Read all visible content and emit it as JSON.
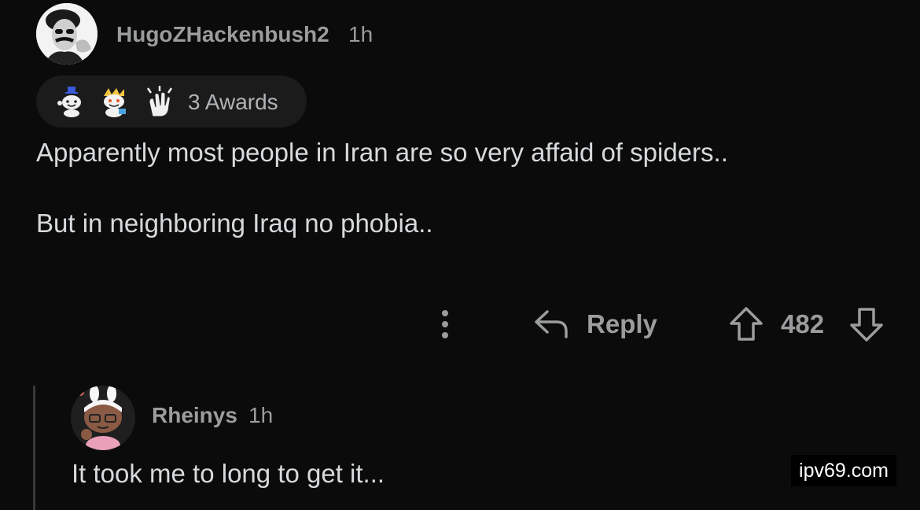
{
  "colors": {
    "background": "#0b0b0b",
    "text_primary": "#d7dadc",
    "text_secondary": "#9a9c9e",
    "pill_background": "#1b1b1c",
    "thread_line": "#3a3a3c"
  },
  "comment": {
    "username": "HugoZHackenbush2",
    "time": "1h",
    "avatar_icon": "avatar-groucho-icon",
    "awards": {
      "icons": [
        "award-wholesome-icon",
        "award-snoo-icon",
        "award-clapping-hands-icon"
      ],
      "label": "3 Awards"
    },
    "body": [
      "Apparently most people in Iran are so very affaid of spiders..",
      "But in neighboring Iraq no phobia.."
    ],
    "actions": {
      "more_icon": "more-vertical-icon",
      "reply_icon": "reply-arrow-icon",
      "reply_label": "Reply",
      "upvote_icon": "upvote-arrow-icon",
      "score": "482",
      "downvote_icon": "downvote-arrow-icon"
    }
  },
  "reply": {
    "username": "Rheinys",
    "time": "1h",
    "avatar_icon": "avatar-snoo-bunny-icon",
    "body": "It took me to long to get it..."
  },
  "watermark": "ipv69.com"
}
